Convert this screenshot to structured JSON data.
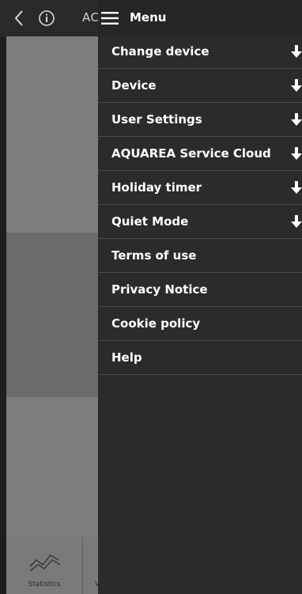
{
  "app": {
    "title": "AC",
    "bottom_nav": {
      "tabs": [
        {
          "label": "Statistics",
          "icon": "statistics-icon"
        },
        {
          "label": "V",
          "icon": ""
        }
      ]
    }
  },
  "menu": {
    "title": "Menu",
    "icon": "hamburger-icon",
    "items": [
      {
        "label": "Change device",
        "expandable": true
      },
      {
        "label": "Device",
        "expandable": true
      },
      {
        "label": "User Settings",
        "expandable": true
      },
      {
        "label": "AQUAREA Service Cloud",
        "expandable": true
      },
      {
        "label": "Holiday timer",
        "expandable": true
      },
      {
        "label": "Quiet Mode",
        "expandable": true
      },
      {
        "label": "Terms of use",
        "expandable": false
      },
      {
        "label": "Privacy Notice",
        "expandable": false
      },
      {
        "label": "Cookie policy",
        "expandable": false
      },
      {
        "label": "Help",
        "expandable": false
      }
    ]
  },
  "colors": {
    "drawer_bg": "#2b2b2b",
    "divider": "#4a4a4a",
    "text": "#ffffff",
    "overlay_gray": "#7d7d7d"
  }
}
